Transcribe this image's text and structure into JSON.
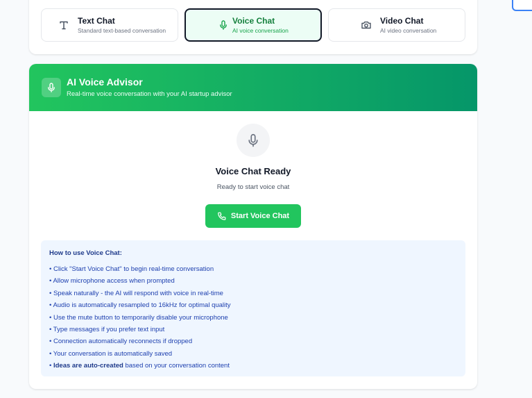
{
  "modes": [
    {
      "id": "text",
      "title": "Text Chat",
      "subtitle": "Standard text-based conversation",
      "icon": "text-icon",
      "active": false
    },
    {
      "id": "voice",
      "title": "Voice Chat",
      "subtitle": "AI voice conversation",
      "icon": "mic-icon",
      "active": true
    },
    {
      "id": "video",
      "title": "Video Chat",
      "subtitle": "AI video conversation",
      "icon": "camera-icon",
      "active": false
    }
  ],
  "voice_panel": {
    "header_icon": "mic-icon",
    "title": "AI Voice Advisor",
    "subtitle": "Real-time voice conversation with your AI startup advisor",
    "status_icon": "mic-icon",
    "status_title": "Voice Chat Ready",
    "status_subtitle": "Ready to start voice chat",
    "start_button": {
      "label": "Start Voice Chat",
      "icon": "phone-icon"
    }
  },
  "howto": {
    "title": "How to use Voice Chat:",
    "items": [
      "• Click \"Start Voice Chat\" to begin real-time conversation",
      "• Allow microphone access when prompted",
      "• Speak naturally - the AI will respond with voice in real-time",
      "• Audio is automatically resampled to 16kHz for optimal quality",
      "• Use the mute button to temporarily disable your microphone",
      "• Type messages if you prefer text input",
      "• Connection automatically reconnects if dropped",
      "• Your conversation is automatically saved"
    ],
    "last_item_bold": "Ideas are auto-created",
    "last_item_rest": " based on your conversation content"
  },
  "colors": {
    "accent": "#22c55e",
    "accent_dark": "#059669",
    "info_bg": "#eff6ff",
    "info_text": "#1e40af"
  }
}
